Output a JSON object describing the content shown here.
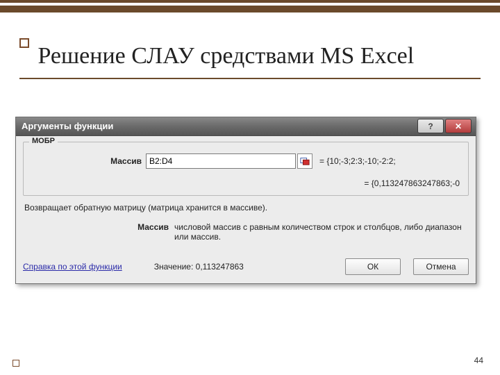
{
  "decor": {
    "page_number": "44"
  },
  "slide": {
    "title": "Решение СЛАУ средствами MS Excel"
  },
  "dialog": {
    "title": "Аргументы функции",
    "function_name": "МОБР",
    "arg_label": "Массив",
    "arg_value": "B2:D4",
    "arg_preview": "= {10;-3;2:3;-10;-2:2;",
    "result_preview": "= {0,113247863247863;-0",
    "description": "Возвращает обратную матрицу (матрица хранится в массиве).",
    "arg_help_label": "Массив",
    "arg_help_text": "числовой массив с равным количеством строк и столбцов, либо диапазон или массив.",
    "help_link": "Справка по этой функции",
    "value_label": "Значение:",
    "value_text": "0,113247863",
    "ok": "ОК",
    "cancel": "Отмена"
  }
}
